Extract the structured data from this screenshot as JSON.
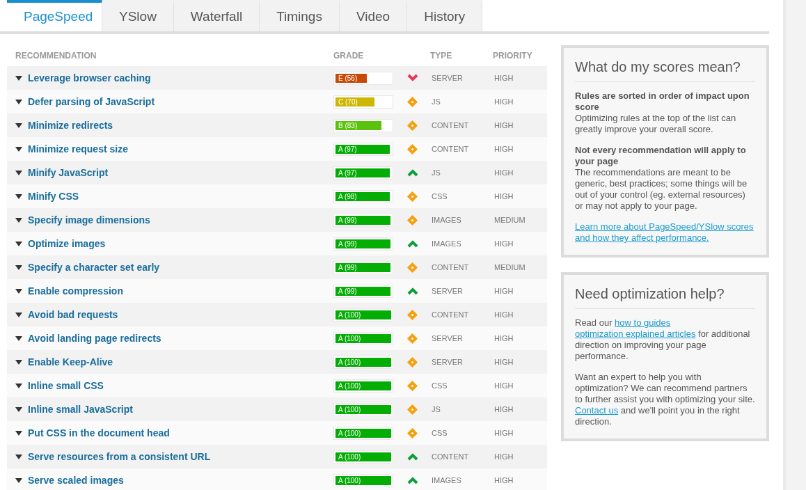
{
  "tabs": [
    {
      "label": "PageSpeed",
      "selected": true
    },
    {
      "label": "YSlow",
      "selected": false
    },
    {
      "label": "Waterfall",
      "selected": false
    },
    {
      "label": "Timings",
      "selected": false
    },
    {
      "label": "Video",
      "selected": false
    },
    {
      "label": "History",
      "selected": false
    }
  ],
  "table": {
    "columns": [
      "RECOMMENDATION",
      "GRADE",
      "TYPE",
      "PRIORITY"
    ],
    "rows": [
      {
        "name": "Leverage browser caching",
        "grade": "E (56)",
        "level": 0.56,
        "color": "#c94a05",
        "kind": "down",
        "type": "SERVER",
        "priority": "HIGH"
      },
      {
        "name": "Defer parsing of JavaScript",
        "grade": "C (70)",
        "level": 0.7,
        "color": "#cdb704",
        "kind": "neutral",
        "type": "JS",
        "priority": "HIGH"
      },
      {
        "name": "Minimize redirects",
        "grade": "B (83)",
        "level": 0.83,
        "color": "#5ac20d",
        "kind": "neutral",
        "type": "CONTENT",
        "priority": "HIGH"
      },
      {
        "name": "Minimize request size",
        "grade": "A (97)",
        "level": 0.97,
        "color": "#04ad04",
        "kind": "neutral",
        "type": "CONTENT",
        "priority": "HIGH"
      },
      {
        "name": "Minify JavaScript",
        "grade": "A (97)",
        "level": 0.97,
        "color": "#04ad04",
        "kind": "up",
        "type": "JS",
        "priority": "HIGH"
      },
      {
        "name": "Minify CSS",
        "grade": "A (98)",
        "level": 0.98,
        "color": "#04ad04",
        "kind": "neutral",
        "type": "CSS",
        "priority": "HIGH"
      },
      {
        "name": "Specify image dimensions",
        "grade": "A (99)",
        "level": 0.99,
        "color": "#04ad04",
        "kind": "neutral",
        "type": "IMAGES",
        "priority": "MEDIUM"
      },
      {
        "name": "Optimize images",
        "grade": "A (99)",
        "level": 0.99,
        "color": "#04ad04",
        "kind": "up",
        "type": "IMAGES",
        "priority": "HIGH"
      },
      {
        "name": "Specify a character set early",
        "grade": "A (99)",
        "level": 0.99,
        "color": "#04ad04",
        "kind": "neutral",
        "type": "CONTENT",
        "priority": "MEDIUM"
      },
      {
        "name": "Enable compression",
        "grade": "A (99)",
        "level": 0.99,
        "color": "#04ad04",
        "kind": "up",
        "type": "SERVER",
        "priority": "HIGH"
      },
      {
        "name": "Avoid bad requests",
        "grade": "A (100)",
        "level": 1,
        "color": "#04ad04",
        "kind": "neutral",
        "type": "CONTENT",
        "priority": "HIGH"
      },
      {
        "name": "Avoid landing page redirects",
        "grade": "A (100)",
        "level": 1,
        "color": "#04ad04",
        "kind": "neutral",
        "type": "SERVER",
        "priority": "HIGH"
      },
      {
        "name": "Enable Keep-Alive",
        "grade": "A (100)",
        "level": 1,
        "color": "#04ad04",
        "kind": "neutral",
        "type": "SERVER",
        "priority": "HIGH"
      },
      {
        "name": "Inline small CSS",
        "grade": "A (100)",
        "level": 1,
        "color": "#04ad04",
        "kind": "neutral",
        "type": "CSS",
        "priority": "HIGH"
      },
      {
        "name": "Inline small JavaScript",
        "grade": "A (100)",
        "level": 1,
        "color": "#04ad04",
        "kind": "neutral",
        "type": "JS",
        "priority": "HIGH"
      },
      {
        "name": "Put CSS in the document head",
        "grade": "A (100)",
        "level": 1,
        "color": "#04ad04",
        "kind": "neutral",
        "type": "CSS",
        "priority": "HIGH"
      },
      {
        "name": "Serve resources from a consistent URL",
        "grade": "A (100)",
        "level": 1,
        "color": "#04ad04",
        "kind": "up",
        "type": "CONTENT",
        "priority": "HIGH"
      },
      {
        "name": "Serve scaled images",
        "grade": "A (100)",
        "level": 1,
        "color": "#04ad04",
        "kind": "up",
        "type": "IMAGES",
        "priority": "HIGH"
      }
    ]
  },
  "panels": [
    {
      "title": "What do my scores mean?",
      "paragraphs": [
        {
          "heading": "Rules are sorted in order of impact upon score",
          "parts": [
            {
              "kind": "text",
              "text": "Optimizing rules at the top of the list can greatly improve your overall score."
            }
          ]
        },
        {
          "heading": "Not every recommendation will apply to your page",
          "parts": [
            {
              "kind": "text",
              "text": "The recommendations are meant to be generic, best practices; some things will be out of your control (eg. external resources) or may not apply to your page."
            }
          ]
        },
        {
          "parts": [
            {
              "kind": "link",
              "text": "Learn more about PageSpeed/YSlow scores and how they affect performance."
            }
          ]
        }
      ]
    },
    {
      "title": "Need optimization help?",
      "paragraphs": [
        {
          "parts": [
            {
              "kind": "text",
              "text": "Read our"
            },
            {
              "kind": "link",
              "text": "how to guides"
            },
            {
              "kind": "link",
              "text": "optimization explained articles"
            },
            {
              "kind": "text",
              "text": "for additional direction on improving your page performance."
            }
          ]
        },
        {
          "parts": [
            {
              "kind": "text",
              "text": "Want an expert to help you with optimization? We can recommend partners to further assist you with optimizing your site."
            },
            {
              "kind": "link",
              "text": "Contact us"
            },
            {
              "kind": "text",
              "text": "and we'll point you in the right direction."
            }
          ]
        }
      ]
    }
  ]
}
